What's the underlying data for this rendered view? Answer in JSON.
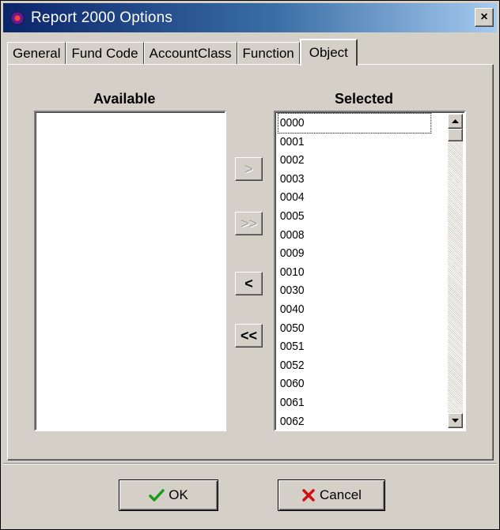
{
  "window": {
    "title": "Report 2000 Options",
    "close_glyph": "×"
  },
  "tabs": [
    {
      "label": "General",
      "active": false
    },
    {
      "label": "Fund Code",
      "active": false
    },
    {
      "label": "AccountClass",
      "active": false
    },
    {
      "label": "Function",
      "active": false
    },
    {
      "label": "Object",
      "active": true
    }
  ],
  "available": {
    "heading": "Available",
    "items": []
  },
  "selected": {
    "heading": "Selected",
    "items": [
      "0000",
      "0001",
      "0002",
      "0003",
      "0004",
      "0005",
      "0008",
      "0009",
      "0010",
      "0030",
      "0040",
      "0050",
      "0051",
      "0052",
      "0060",
      "0061",
      "0062"
    ],
    "focused_index": 0
  },
  "move_buttons": {
    "add_one": {
      "label": ">",
      "enabled": false
    },
    "add_all": {
      "label": ">>",
      "enabled": false
    },
    "remove_one": {
      "label": "<",
      "enabled": true
    },
    "remove_all": {
      "label": "<<",
      "enabled": true
    }
  },
  "footer": {
    "ok_label": "OK",
    "cancel_label": "Cancel"
  },
  "icons": {
    "app": "app-icon",
    "ok": "checkmark-icon",
    "cancel": "x-icon"
  },
  "colors": {
    "title_bar": "#0a246a",
    "ok_check": "#1a9a1a",
    "cancel_x": "#d01010"
  }
}
